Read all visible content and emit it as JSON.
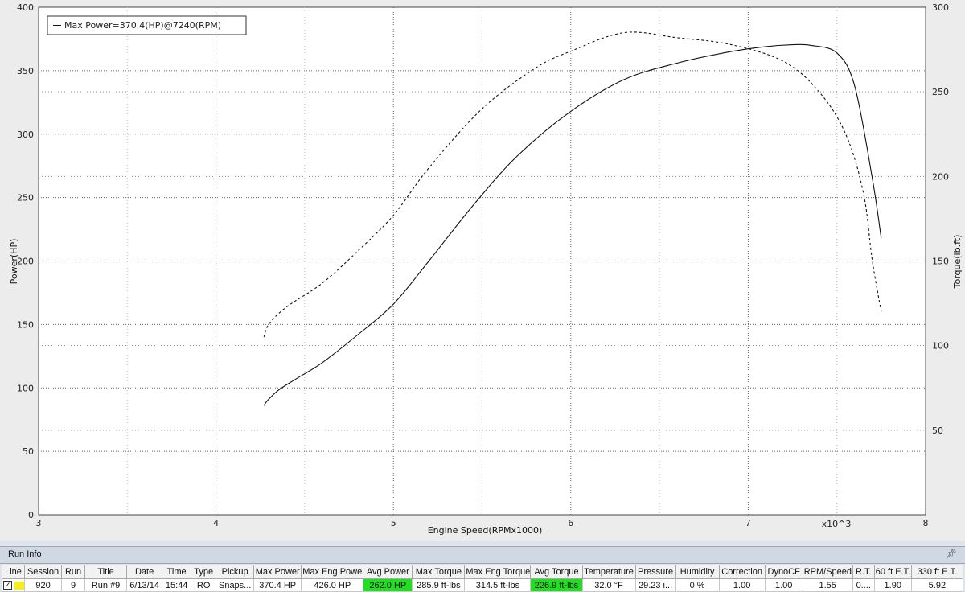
{
  "chart_data": {
    "type": "line",
    "xlabel": "Engine Speed(RPMx1000)",
    "x_multiplier_label": "x10^3",
    "ylabel": "Power(HP)",
    "ylabel_right": "Torque(lb.ft)",
    "xlim": [
      3,
      8
    ],
    "ylim": [
      0,
      400
    ],
    "ylim_right": [
      0,
      300
    ],
    "x_ticks": [
      "3",
      "4",
      "5",
      "6",
      "7",
      "8"
    ],
    "y_ticks": [
      "0",
      "50",
      "100",
      "150",
      "200",
      "250",
      "300",
      "350",
      "400"
    ],
    "y_ticks_right": [
      "50",
      "100",
      "150",
      "200",
      "250",
      "300"
    ],
    "grid": true,
    "legend": {
      "placement": "top-left",
      "entries": [
        "Max Power=370.4(HP)@7240(RPM)"
      ]
    },
    "series": [
      {
        "name": "Max Power=370.4(HP)@7240(RPM)",
        "axis": "left",
        "style": "solid",
        "x": [
          4.27,
          4.29,
          4.35,
          4.45,
          4.6,
          4.8,
          5.0,
          5.2,
          5.45,
          5.7,
          6.0,
          6.3,
          6.6,
          6.9,
          7.1,
          7.24,
          7.35,
          7.5,
          7.6,
          7.7,
          7.75
        ],
        "y": [
          86,
          90,
          98,
          107,
          120,
          142,
          166,
          200,
          244,
          283,
          318,
          343,
          356,
          365,
          369,
          370.4,
          370,
          364,
          338,
          265,
          218
        ]
      },
      {
        "name": "Torque",
        "axis": "right",
        "style": "dashed",
        "x": [
          4.27,
          4.3,
          4.4,
          4.6,
          4.8,
          5.0,
          5.2,
          5.5,
          5.8,
          6.0,
          6.3,
          6.6,
          6.9,
          7.2,
          7.4,
          7.55,
          7.65,
          7.7,
          7.75
        ],
        "y": [
          105,
          113,
          123,
          137,
          156,
          177,
          205,
          240,
          264,
          274,
          285,
          282,
          278,
          268,
          250,
          225,
          190,
          150,
          120
        ]
      }
    ]
  },
  "runinfo": {
    "title": "Run Info",
    "pin_icon": "pin-icon",
    "columns": [
      "Line",
      "Session",
      "Run",
      "Title",
      "Date",
      "Time",
      "Type",
      "Pickup",
      "Max Power",
      "Max Eng Power",
      "Avg Power",
      "Max Torque",
      "Max Eng Torque",
      "Avg Torque",
      "Temperature",
      "Pressure",
      "Humidity",
      "Correction",
      "DynoCF",
      "RPM/Speed",
      "R.T.",
      "60 ft E.T.",
      "330 ft E.T."
    ],
    "row": {
      "checked": "✓",
      "line_color": "#f7ef1a",
      "session": "920",
      "run": "9",
      "title": "Run #9",
      "date": "6/13/14",
      "time": "15:44",
      "type": "RO",
      "pickup": "Snaps...",
      "max_power": "370.4 HP",
      "max_eng_power": "426.0 HP",
      "avg_power": "262.0 HP",
      "max_torque": "285.9 ft-lbs",
      "max_eng_torque": "314.5 ft-lbs",
      "avg_torque": "226.9 ft-lbs",
      "temperature": "32.0 °F",
      "pressure": "29.23 i...",
      "humidity": "0 %",
      "correction": "1.00",
      "dynocf": "1.00",
      "rpm_speed": "1.55",
      "rt": "0....",
      "et60": "1.90",
      "et330": "5.92"
    },
    "highlight_color": "#22dd22"
  }
}
